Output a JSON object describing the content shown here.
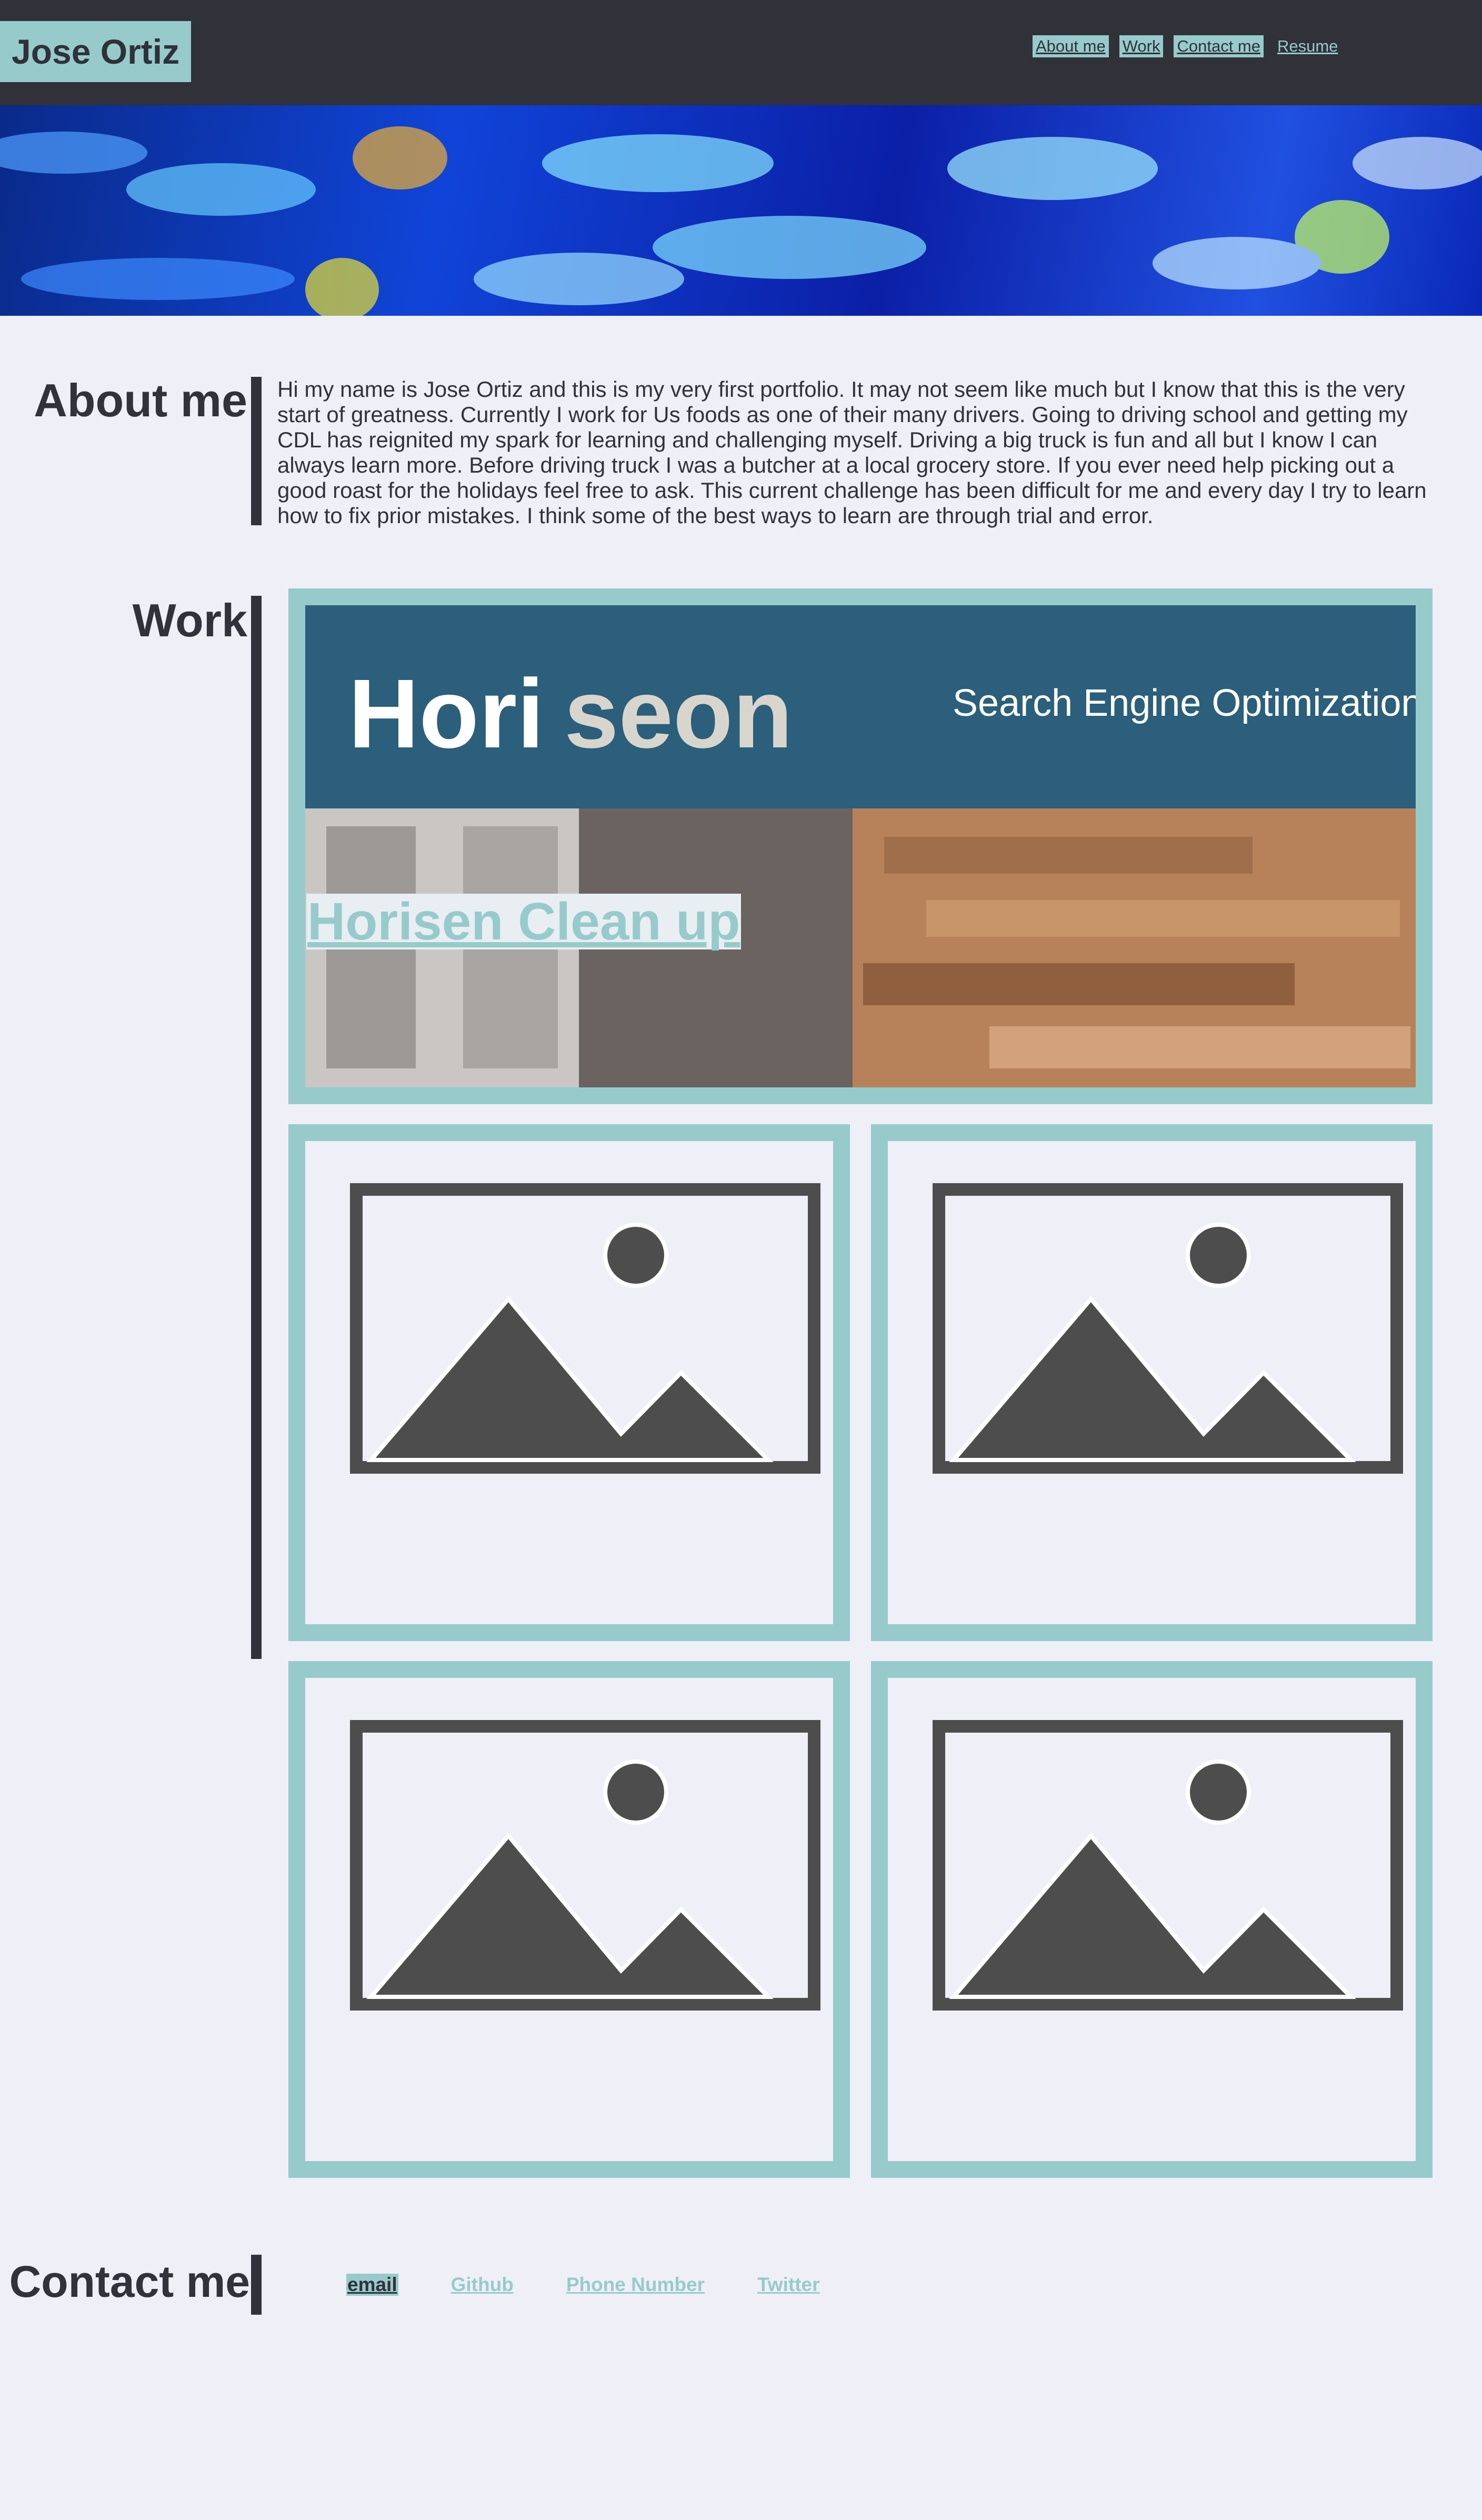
{
  "header": {
    "brand": "Jose Ortiz",
    "nav": [
      {
        "label": "About me"
      },
      {
        "label": "Work"
      },
      {
        "label": "Contact me"
      },
      {
        "label": "Resume"
      }
    ]
  },
  "about": {
    "title": "About me",
    "text": "Hi my name is Jose Ortiz and this is my very first portfolio. It may not seem like much but I know that this is the very start of greatness. Currently I work for Us foods as one of their many drivers. Going to driving school and getting my CDL has reignited my spark for learning and challenging myself. Driving a big truck is fun and all but I know I can always learn more. Before driving truck I was a butcher at a local grocery store. If you ever need help picking out a good roast for the holidays feel free to ask. This current challenge has been difficult for me and every day I try to learn how to fix prior mistakes. I think some of the best ways to learn are through trial and error."
  },
  "work": {
    "title": "Work",
    "featured": {
      "label": "Horisen Clean up",
      "screenshot_logo_a": "Hori",
      "screenshot_logo_b": "seon",
      "screenshot_tagline": "Search Engine Optimization"
    },
    "placeholders": 4
  },
  "contact": {
    "title": "Contact me",
    "links": [
      {
        "label": "email"
      },
      {
        "label": "Github"
      },
      {
        "label": "Phone Number"
      },
      {
        "label": "Twitter"
      }
    ]
  },
  "colors": {
    "accent": "#97cbcb",
    "dark": "#303139",
    "background": "#efeff7"
  }
}
